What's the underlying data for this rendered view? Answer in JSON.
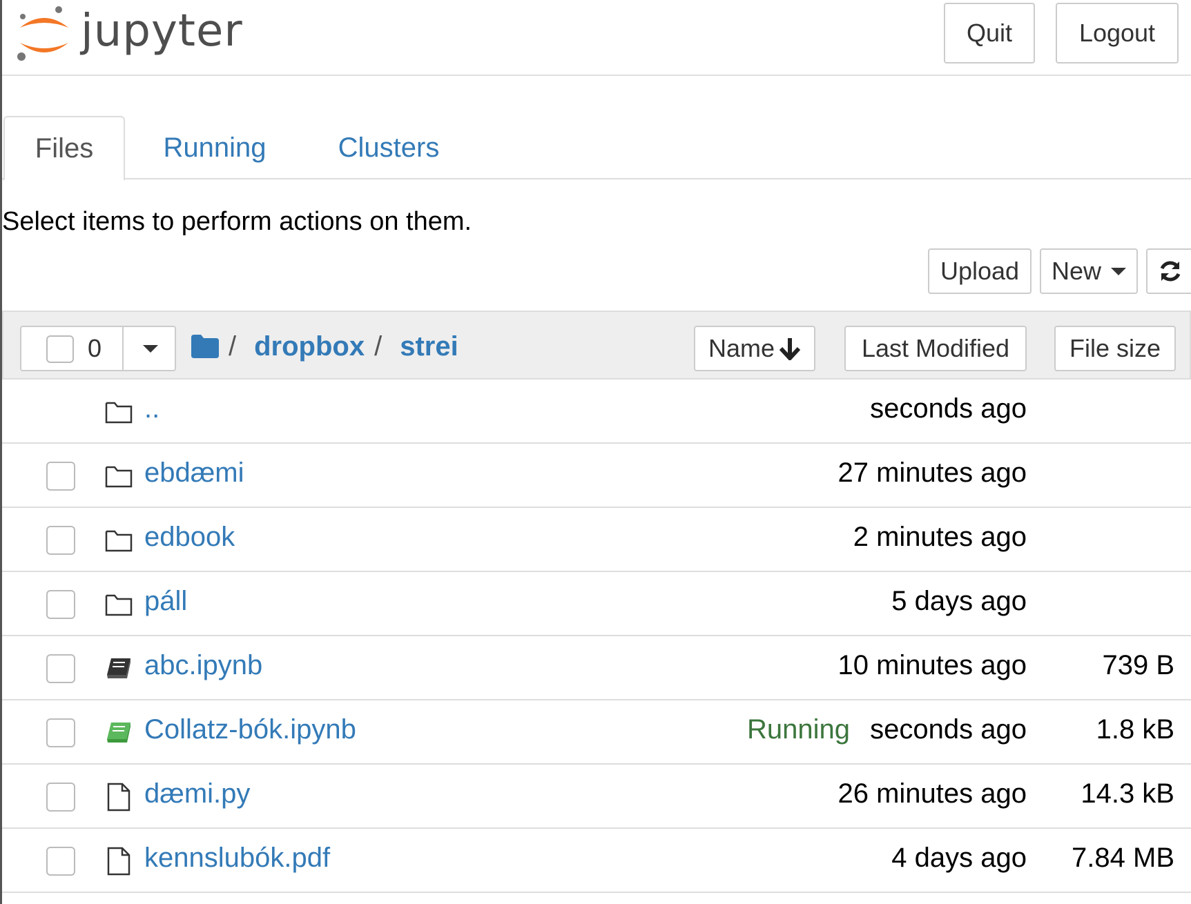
{
  "header": {
    "logo_text": "jupyter",
    "quit_label": "Quit",
    "logout_label": "Logout"
  },
  "tabs": [
    {
      "label": "Files",
      "active": true
    },
    {
      "label": "Running",
      "active": false
    },
    {
      "label": "Clusters",
      "active": false
    }
  ],
  "instruction": "Select items to perform actions on them.",
  "toolbar": {
    "upload_label": "Upload",
    "new_label": "New",
    "refresh_icon": "refresh-icon"
  },
  "list_header": {
    "selected_count": "0",
    "breadcrumb": {
      "root": "/",
      "items": [
        "dropbox",
        "strei"
      ],
      "separator": "/"
    },
    "sort_name_label": "Name",
    "sort_modified_label": "Last Modified",
    "sort_size_label": "File size"
  },
  "rows": [
    {
      "type": "folder",
      "name": "..",
      "running": "",
      "modified": "seconds ago",
      "size": "",
      "has_checkbox": false
    },
    {
      "type": "folder",
      "name": "ebdæmi",
      "running": "",
      "modified": "27 minutes ago",
      "size": "",
      "has_checkbox": true
    },
    {
      "type": "folder",
      "name": "edbook",
      "running": "",
      "modified": "2 minutes ago",
      "size": "",
      "has_checkbox": true
    },
    {
      "type": "folder",
      "name": "páll",
      "running": "",
      "modified": "5 days ago",
      "size": "",
      "has_checkbox": true
    },
    {
      "type": "notebook",
      "name": "abc.ipynb",
      "running": "",
      "modified": "10 minutes ago",
      "size": "739 B",
      "has_checkbox": true
    },
    {
      "type": "notebook-running",
      "name": "Collatz-bók.ipynb",
      "running": "Running",
      "modified": "seconds ago",
      "size": "1.8 kB",
      "has_checkbox": true
    },
    {
      "type": "file",
      "name": "dæmi.py",
      "running": "",
      "modified": "26 minutes ago",
      "size": "14.3 kB",
      "has_checkbox": true
    },
    {
      "type": "file",
      "name": "kennslubók.pdf",
      "running": "",
      "modified": "4 days ago",
      "size": "7.84 MB",
      "has_checkbox": true
    }
  ],
  "colors": {
    "link": "#337ab7",
    "running": "#3c763d",
    "logo_orange": "#f37726",
    "logo_gray": "#767677"
  }
}
